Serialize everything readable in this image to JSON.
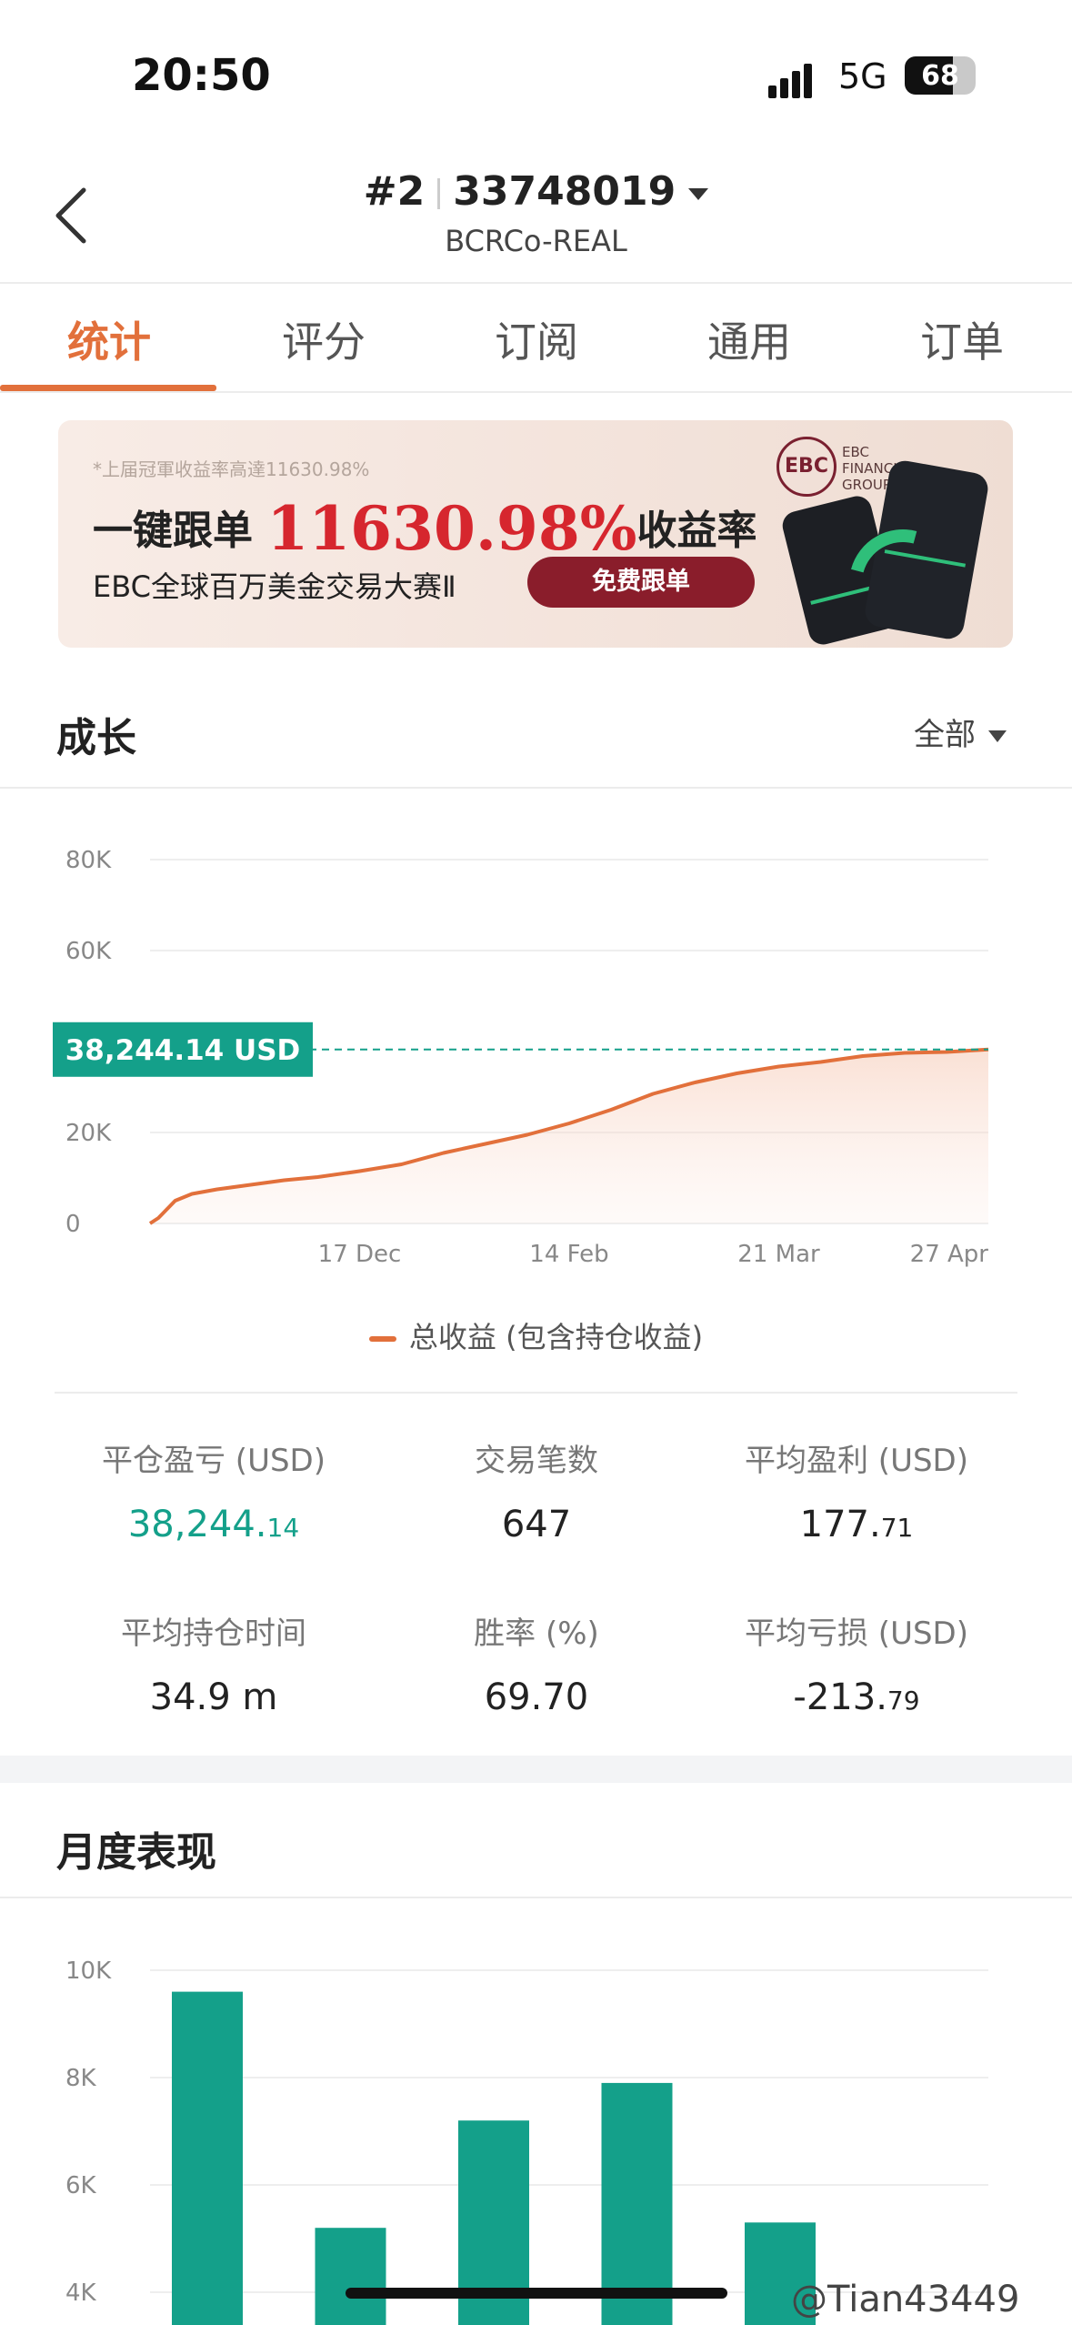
{
  "status": {
    "time": "20:50",
    "network": "5G",
    "battery_level": "68",
    "battery_fraction": 0.68
  },
  "header": {
    "rank": "#2",
    "account": "33748019",
    "server": "BCRCo-REAL"
  },
  "tabs": [
    {
      "label": "统计",
      "active": true
    },
    {
      "label": "评分",
      "active": false
    },
    {
      "label": "订阅",
      "active": false
    },
    {
      "label": "通用",
      "active": false
    },
    {
      "label": "订单",
      "active": false
    }
  ],
  "banner": {
    "note": "*上届冠軍收益率高達11630.98%",
    "headline_prefix": "一键跟单",
    "headline_value": "11630.98%",
    "headline_suffix": "收益率",
    "subtitle": "EBC全球百万美金交易大赛Ⅱ",
    "button": "免费跟单",
    "logo_text": "EBC",
    "brand_lines": [
      "EBC",
      "FINANCIAL",
      "GROUP"
    ]
  },
  "growth": {
    "title": "成长",
    "filter": "全部",
    "current_label": "38,244.14 USD",
    "legend": "总收益 (包含持仓收益)",
    "colors": {
      "line": "#e2703b",
      "badge": "#14a08a"
    }
  },
  "chart_data": [
    {
      "type": "area",
      "ylim": [
        0,
        80000
      ],
      "yticks": [
        "80K",
        "60K",
        "20K",
        "0"
      ],
      "yticks_values": [
        80000,
        60000,
        20000,
        0
      ],
      "xticks": [
        "17 Dec",
        "14 Feb",
        "21 Mar",
        "27 Apr"
      ],
      "xticks_positions": [
        0.25,
        0.5,
        0.75,
        1.0
      ],
      "series": [
        {
          "name": "总收益 (包含持仓收益)",
          "x": [
            0,
            0.01,
            0.03,
            0.05,
            0.08,
            0.12,
            0.16,
            0.2,
            0.25,
            0.3,
            0.35,
            0.4,
            0.45,
            0.5,
            0.55,
            0.6,
            0.65,
            0.7,
            0.75,
            0.8,
            0.85,
            0.9,
            0.95,
            1.0
          ],
          "values": [
            0,
            1200,
            5000,
            6500,
            7500,
            8500,
            9500,
            10200,
            11500,
            13000,
            15500,
            17500,
            19500,
            22000,
            25000,
            28500,
            31000,
            33000,
            34500,
            35500,
            36800,
            37500,
            37700,
            38244
          ]
        }
      ],
      "annotation": "38,244.14 USD"
    },
    {
      "type": "bar",
      "ylim": [
        4000,
        10000
      ],
      "yticks": [
        "10K",
        "8K",
        "6K",
        "4K"
      ],
      "yticks_values": [
        10000,
        8000,
        6000,
        4000
      ],
      "categories": [
        "",
        "",
        "",
        "",
        ""
      ],
      "values": [
        9600,
        5200,
        7200,
        7900,
        5300
      ]
    }
  ],
  "stats": [
    {
      "label": "平仓盈亏 (USD)",
      "int": "38,244.",
      "dec": "14",
      "accent": true
    },
    {
      "label": "交易笔数",
      "int": "647",
      "dec": "",
      "accent": false
    },
    {
      "label": "平均盈利 (USD)",
      "int": "177.",
      "dec": "71",
      "accent": false
    },
    {
      "label": "平均持仓时间",
      "int": "34.9 m",
      "dec": "",
      "accent": false
    },
    {
      "label": "胜率 (%)",
      "int": "69.70",
      "dec": "",
      "accent": false
    },
    {
      "label": "平均亏损 (USD)",
      "int": "-213.",
      "dec": "79",
      "accent": false
    }
  ],
  "monthly": {
    "title": "月度表现",
    "bar_color": "#14a08a"
  },
  "watermark": "@Tian43449"
}
